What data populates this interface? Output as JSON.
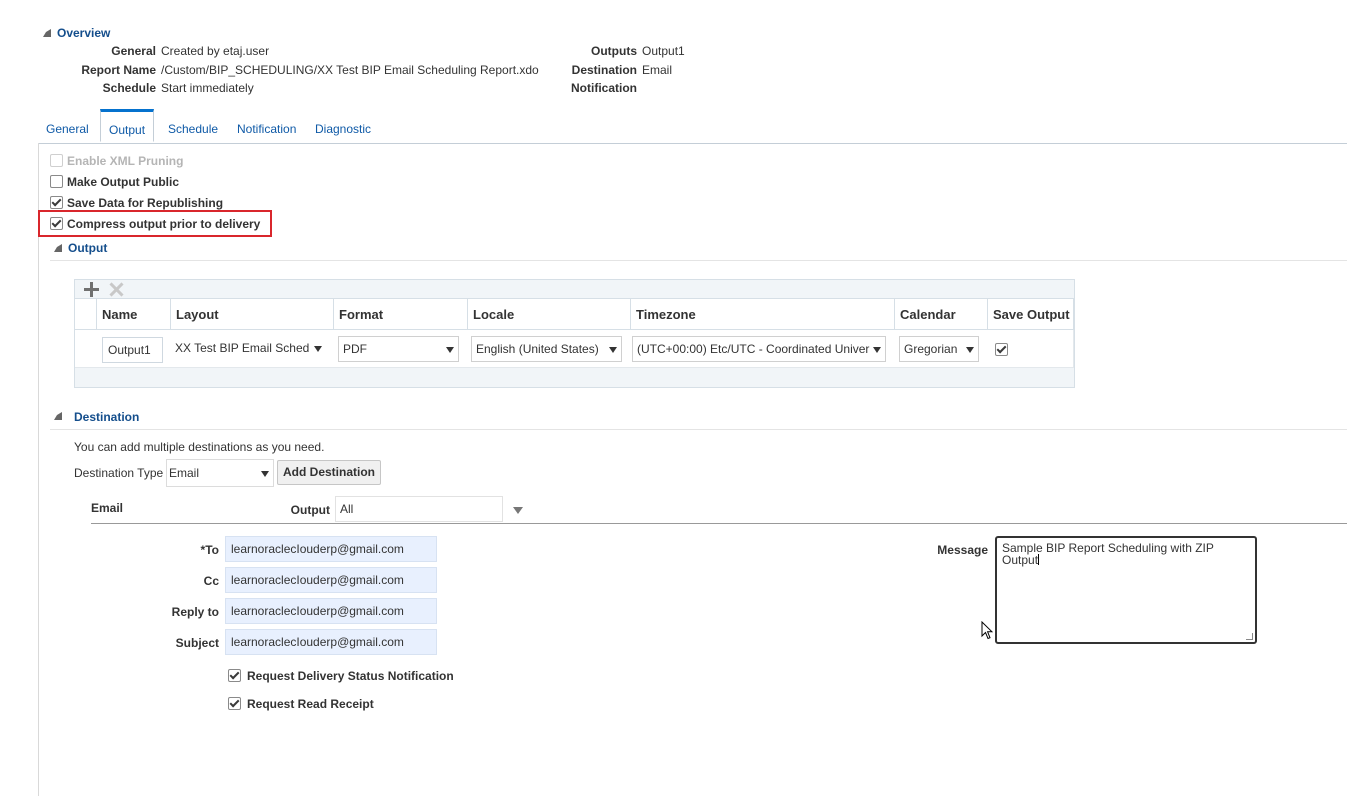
{
  "overview": {
    "title": "Overview",
    "general_label": "General",
    "general_value": "Created by etaj.user",
    "report_name_label": "Report Name",
    "report_name_value": "/Custom/BIP_SCHEDULING/XX Test BIP Email Scheduling Report.xdo",
    "schedule_label": "Schedule",
    "schedule_value": "Start immediately",
    "outputs_label": "Outputs",
    "outputs_value": "Output1",
    "destination_label": "Destination",
    "destination_value": "Email",
    "notification_label": "Notification",
    "notification_value": ""
  },
  "tabs": [
    {
      "label": "General"
    },
    {
      "label": "Output"
    },
    {
      "label": "Schedule"
    },
    {
      "label": "Notification"
    },
    {
      "label": "Diagnostic"
    }
  ],
  "options": {
    "enable_xml_pruning": {
      "label": "Enable XML Pruning",
      "checked": false,
      "disabled": true
    },
    "make_output_public": {
      "label": "Make Output Public",
      "checked": false
    },
    "save_data": {
      "label": "Save Data for Republishing",
      "checked": true
    },
    "compress_output": {
      "label": "Compress output prior to delivery",
      "checked": true
    }
  },
  "output_section": {
    "title": "Output",
    "columns": [
      "Name",
      "Layout",
      "Format",
      "Locale",
      "Timezone",
      "Calendar",
      "Save Output"
    ],
    "row": {
      "name": "Output1",
      "layout": "XX Test BIP Email Sched",
      "format": "PDF",
      "locale": "English (United States)",
      "timezone": "(UTC+00:00) Etc/UTC - Coordinated Univer",
      "calendar": "Gregorian",
      "save_output": true
    }
  },
  "destination_section": {
    "title": "Destination",
    "hint": "You can add multiple destinations as you need.",
    "type_label": "Destination Type",
    "type_value": "Email",
    "add_button": "Add Destination",
    "email_title": "Email",
    "output_label": "Output",
    "output_value": "All",
    "to_label": "*To",
    "to_value": "learnoraclecIouderp@gmail.com",
    "cc_label": "Cc",
    "cc_value": "learnoraclecIouderp@gmail.com",
    "reply_label": "Reply to",
    "reply_value": "learnoraclecIouderp@gmail.com",
    "subject_label": "Subject",
    "subject_value": "learnoraclecIouderp@gmail.com",
    "message_label": "Message",
    "message_value": "Sample BIP Report Scheduling with ZIP Output",
    "delivery_status": {
      "label": "Request Delivery Status Notification",
      "checked": true
    },
    "read_receipt": {
      "label": "Request Read Receipt",
      "checked": true
    }
  },
  "colors": {
    "link": "#0f5aa7",
    "section_title": "#144e8c",
    "highlight": "#d9262c",
    "tab_active": "#0572ce"
  }
}
